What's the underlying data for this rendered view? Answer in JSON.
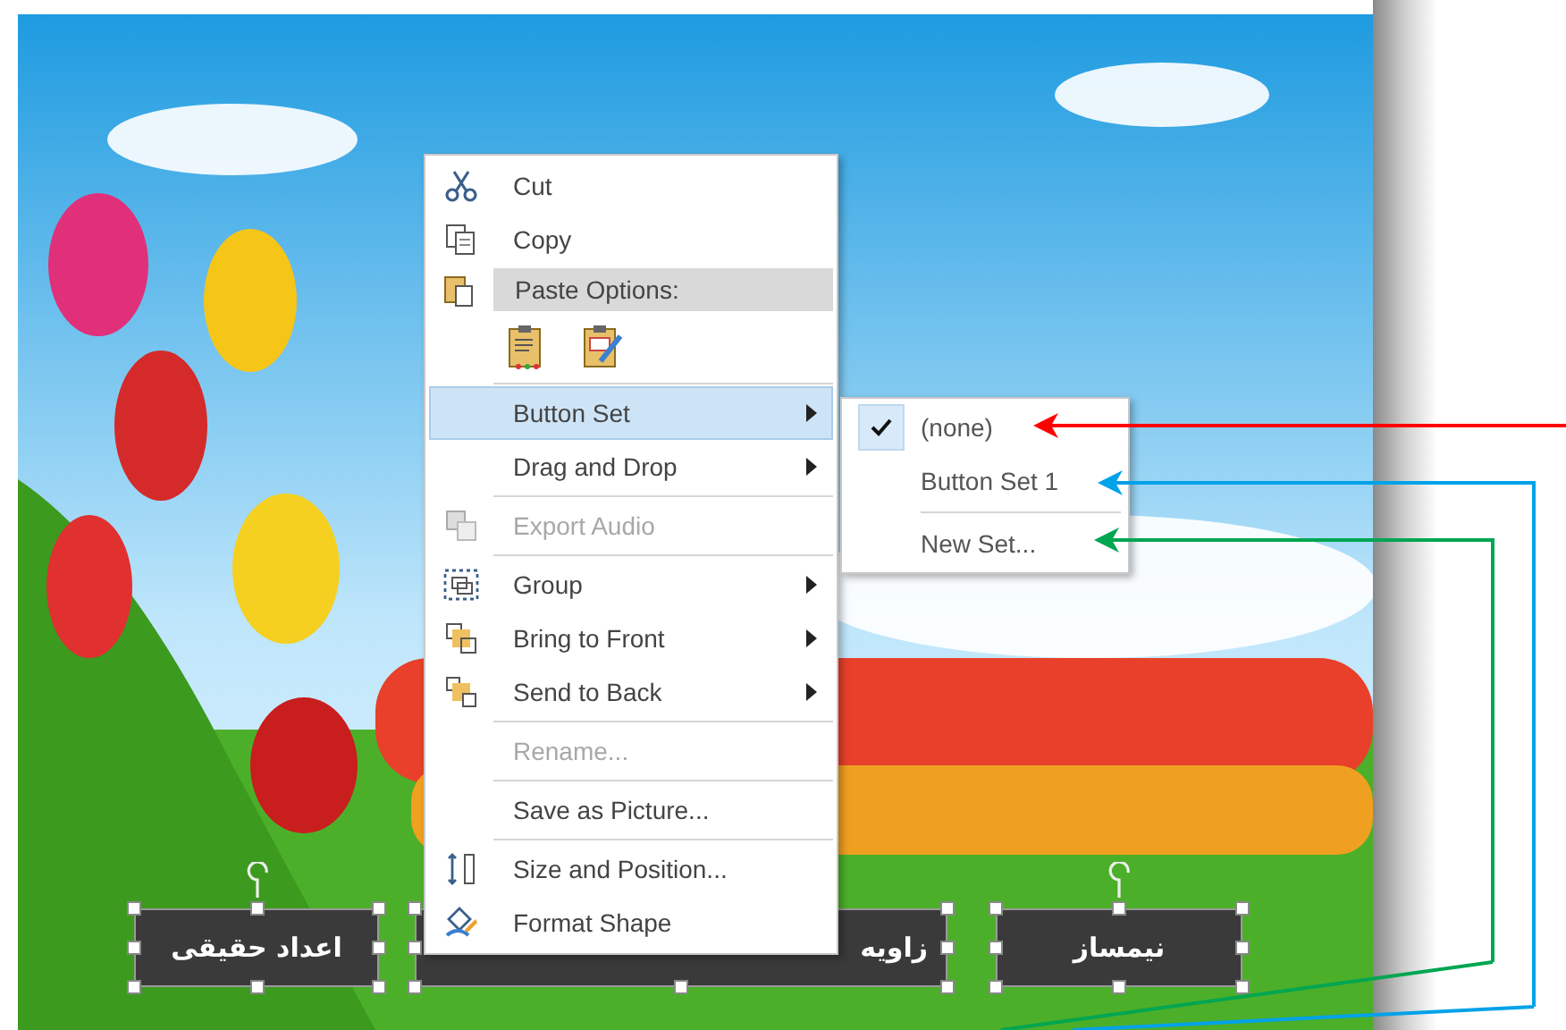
{
  "slide_buttons": [
    {
      "label": "نیمساز",
      "selected": true
    },
    {
      "label": "زاویه",
      "selected": true
    },
    {
      "label": "اعداد حقیقی",
      "selected": true
    }
  ],
  "context_menu": {
    "items": [
      {
        "kind": "item",
        "label": "Cut",
        "disabled": false,
        "selected": false
      },
      {
        "kind": "item",
        "label": "Copy",
        "disabled": false,
        "selected": false
      },
      {
        "kind": "header",
        "label": "Paste Options:"
      },
      {
        "kind": "paste_options"
      },
      {
        "kind": "separator"
      },
      {
        "kind": "submenu",
        "label": "Button Set",
        "disabled": false,
        "selected": true
      },
      {
        "kind": "submenu",
        "label": "Drag and Drop",
        "disabled": false,
        "selected": false
      },
      {
        "kind": "separator"
      },
      {
        "kind": "item",
        "label": "Export Audio",
        "disabled": true,
        "selected": false
      },
      {
        "kind": "separator"
      },
      {
        "kind": "submenu",
        "label": "Group",
        "disabled": false,
        "selected": false
      },
      {
        "kind": "submenu",
        "label": "Bring to Front",
        "disabled": false,
        "selected": false
      },
      {
        "kind": "submenu",
        "label": "Send to Back",
        "disabled": false,
        "selected": false
      },
      {
        "kind": "separator"
      },
      {
        "kind": "item",
        "label": "Rename...",
        "disabled": true,
        "selected": false
      },
      {
        "kind": "separator"
      },
      {
        "kind": "item",
        "label": "Save as Picture...",
        "disabled": false,
        "selected": false
      },
      {
        "kind": "separator"
      },
      {
        "kind": "item",
        "label": "Size and Position...",
        "disabled": false,
        "selected": false
      },
      {
        "kind": "item",
        "label": "Format Shape",
        "disabled": false,
        "selected": false
      }
    ]
  },
  "submenu": {
    "items": [
      {
        "kind": "item",
        "label": "(none)",
        "checked": true
      },
      {
        "kind": "item",
        "label": "Button Set 1",
        "checked": false
      },
      {
        "kind": "separator"
      },
      {
        "kind": "item",
        "label": "New Set...",
        "checked": false
      }
    ]
  },
  "annotation_arrows": [
    {
      "color": "#ff0000"
    },
    {
      "color": "#00a2e8"
    },
    {
      "color": "#00a651"
    }
  ]
}
